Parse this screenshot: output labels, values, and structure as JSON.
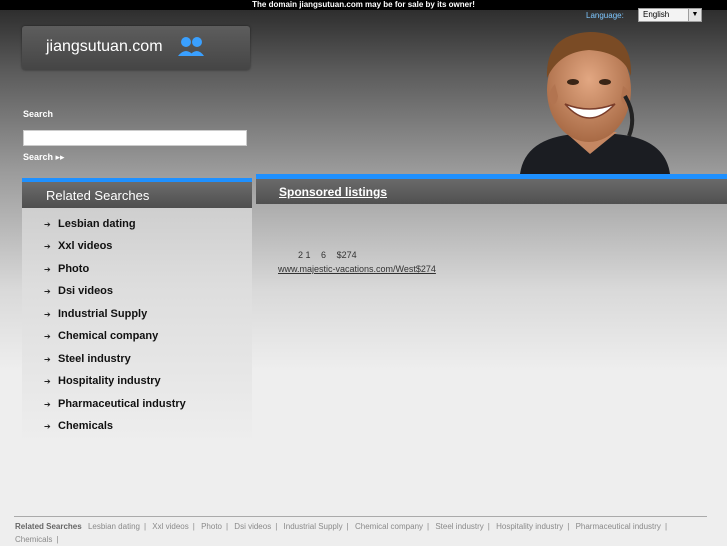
{
  "topbar": {
    "notice": "The domain jiangsutuan.com may be for sale by its owner!"
  },
  "header": {
    "logo_text": "jiangsutuan.com",
    "language_label": "Language:",
    "language_value": "English"
  },
  "search": {
    "title": "Search",
    "button": "Search ▸▸",
    "placeholder": ""
  },
  "related": {
    "title": "Related Searches",
    "items": [
      "Lesbian dating",
      "Xxl videos",
      "Photo",
      "Dsi videos",
      "Industrial Supply",
      "Chemical company",
      "Steel industry",
      "Hospitality industry",
      "Pharmaceutical industry",
      "Chemicals"
    ]
  },
  "sponsored": {
    "title": "Sponsored listings",
    "line_parts": [
      "2 1",
      "6",
      "$274"
    ],
    "url": "www.majestic-vacations.com/West$274"
  },
  "footer": {
    "label": "Related Searches",
    "items": [
      "Lesbian dating",
      "Xxl videos",
      "Photo",
      "Dsi videos",
      "Industrial Supply",
      "Chemical company",
      "Steel industry",
      "Hospitality industry",
      "Pharmaceutical industry",
      "Chemicals"
    ]
  },
  "colors": {
    "accent": "#1e90ff",
    "link_blue": "#7ec7ff"
  }
}
